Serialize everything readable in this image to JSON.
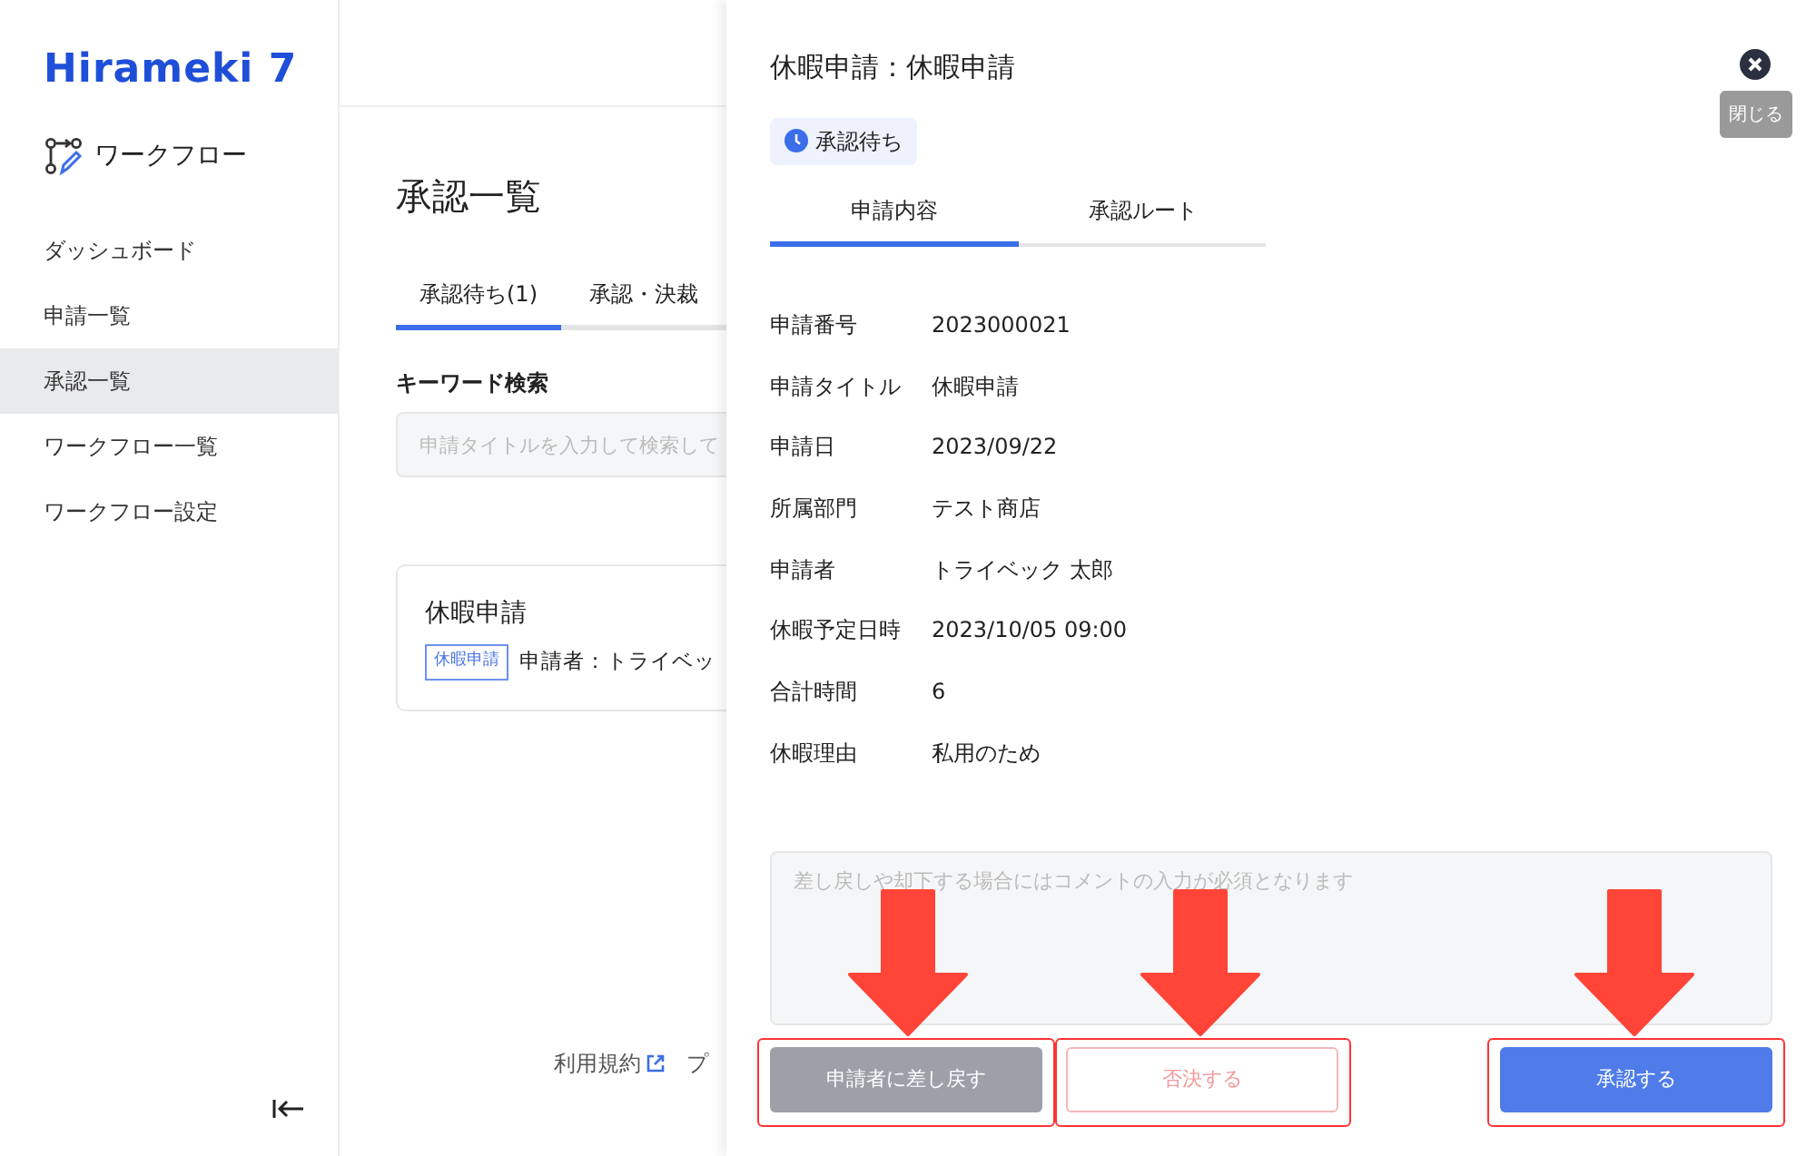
{
  "sidebar": {
    "logo": "Hirameki 7",
    "app_title": "ワークフロー",
    "items": [
      {
        "label": "ダッシュボード",
        "selected": false
      },
      {
        "label": "申請一覧",
        "selected": false
      },
      {
        "label": "承認一覧",
        "selected": true
      },
      {
        "label": "ワークフロー一覧",
        "selected": false
      },
      {
        "label": "ワークフロー設定",
        "selected": false
      }
    ]
  },
  "main": {
    "title": "承認一覧",
    "tabs": [
      {
        "label": "承認待ち(1)",
        "selected": true
      },
      {
        "label": "承認・決裁",
        "selected": false
      }
    ],
    "search": {
      "label": "キーワード検索",
      "placeholder": "申請タイトルを入力して検索して"
    },
    "card": {
      "title": "休暇申請",
      "tag": "休暇申請",
      "applicant": "申請者：トライベッ"
    },
    "footer": [
      "利用規約",
      "プ"
    ]
  },
  "panel": {
    "title": "休暇申請：休暇申請",
    "status": "承認待ち",
    "close_tooltip": "閉じる",
    "tabs": [
      {
        "label": "申請内容",
        "selected": true
      },
      {
        "label": "承認ルート",
        "selected": false
      }
    ],
    "fields": [
      {
        "label": "申請番号",
        "value": "2023000021"
      },
      {
        "label": "申請タイトル",
        "value": "休暇申請"
      },
      {
        "label": "申請日",
        "value": "2023/09/22"
      },
      {
        "label": "所属部門",
        "value": "テスト商店"
      },
      {
        "label": "申請者",
        "value": "トライベック 太郎"
      },
      {
        "label": "休暇予定日時",
        "value": "2023/10/05 09:00"
      },
      {
        "label": "合計時間",
        "value": "6"
      },
      {
        "label": "休暇理由",
        "value": "私用のため"
      }
    ],
    "comment": {
      "placeholder": "差し戻しや却下する場合にはコメントの入力が必須となります"
    },
    "buttons": [
      {
        "label": "申請者に差し戻す",
        "kind": "return",
        "disabled": true
      },
      {
        "label": "否決する",
        "kind": "reject",
        "disabled": true
      },
      {
        "label": "承認する",
        "kind": "approve",
        "disabled": false
      }
    ]
  }
}
